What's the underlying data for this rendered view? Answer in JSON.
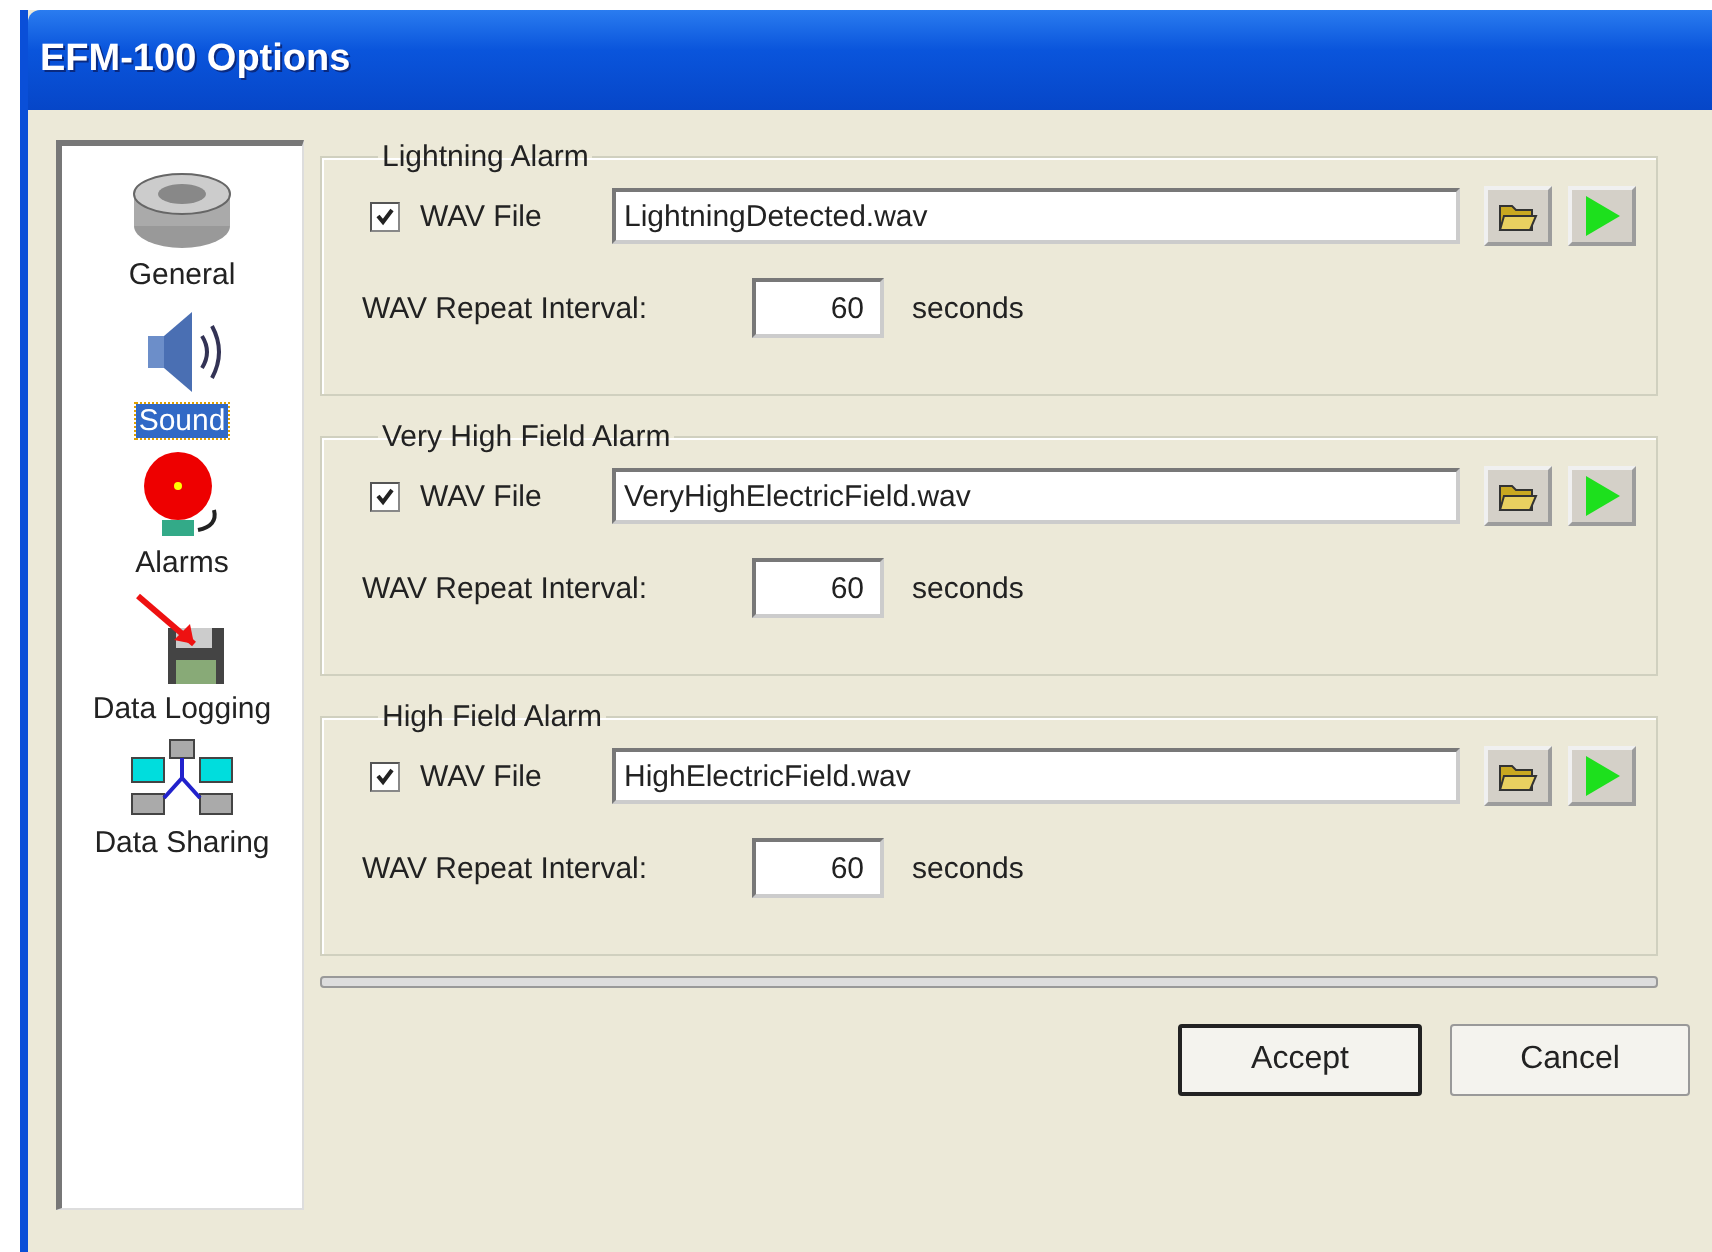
{
  "window": {
    "title": "EFM-100 Options"
  },
  "sidebar": {
    "items": [
      {
        "label": "General",
        "kind": "general",
        "selected": false
      },
      {
        "label": "Sound",
        "kind": "sound",
        "selected": true
      },
      {
        "label": "Alarms",
        "kind": "alarms",
        "selected": false
      },
      {
        "label": "Data Logging",
        "kind": "logging",
        "selected": false
      },
      {
        "label": "Data Sharing",
        "kind": "sharing",
        "selected": false
      }
    ]
  },
  "alarms": [
    {
      "title": "Lightning Alarm",
      "wav_checked": true,
      "wav_label": "WAV File",
      "wav_file": "LightningDetected.wav",
      "interval_label": "WAV Repeat Interval:",
      "interval": "60",
      "unit": "seconds"
    },
    {
      "title": "Very High Field Alarm",
      "wav_checked": true,
      "wav_label": "WAV File",
      "wav_file": "VeryHighElectricField.wav",
      "interval_label": "WAV Repeat Interval:",
      "interval": "60",
      "unit": "seconds"
    },
    {
      "title": "High Field Alarm",
      "wav_checked": true,
      "wav_label": "WAV File",
      "wav_file": "HighElectricField.wav",
      "interval_label": "WAV Repeat Interval:",
      "interval": "60",
      "unit": "seconds"
    }
  ],
  "buttons": [
    {
      "label": "Accept",
      "default": true
    },
    {
      "label": "Cancel",
      "default": false
    }
  ]
}
